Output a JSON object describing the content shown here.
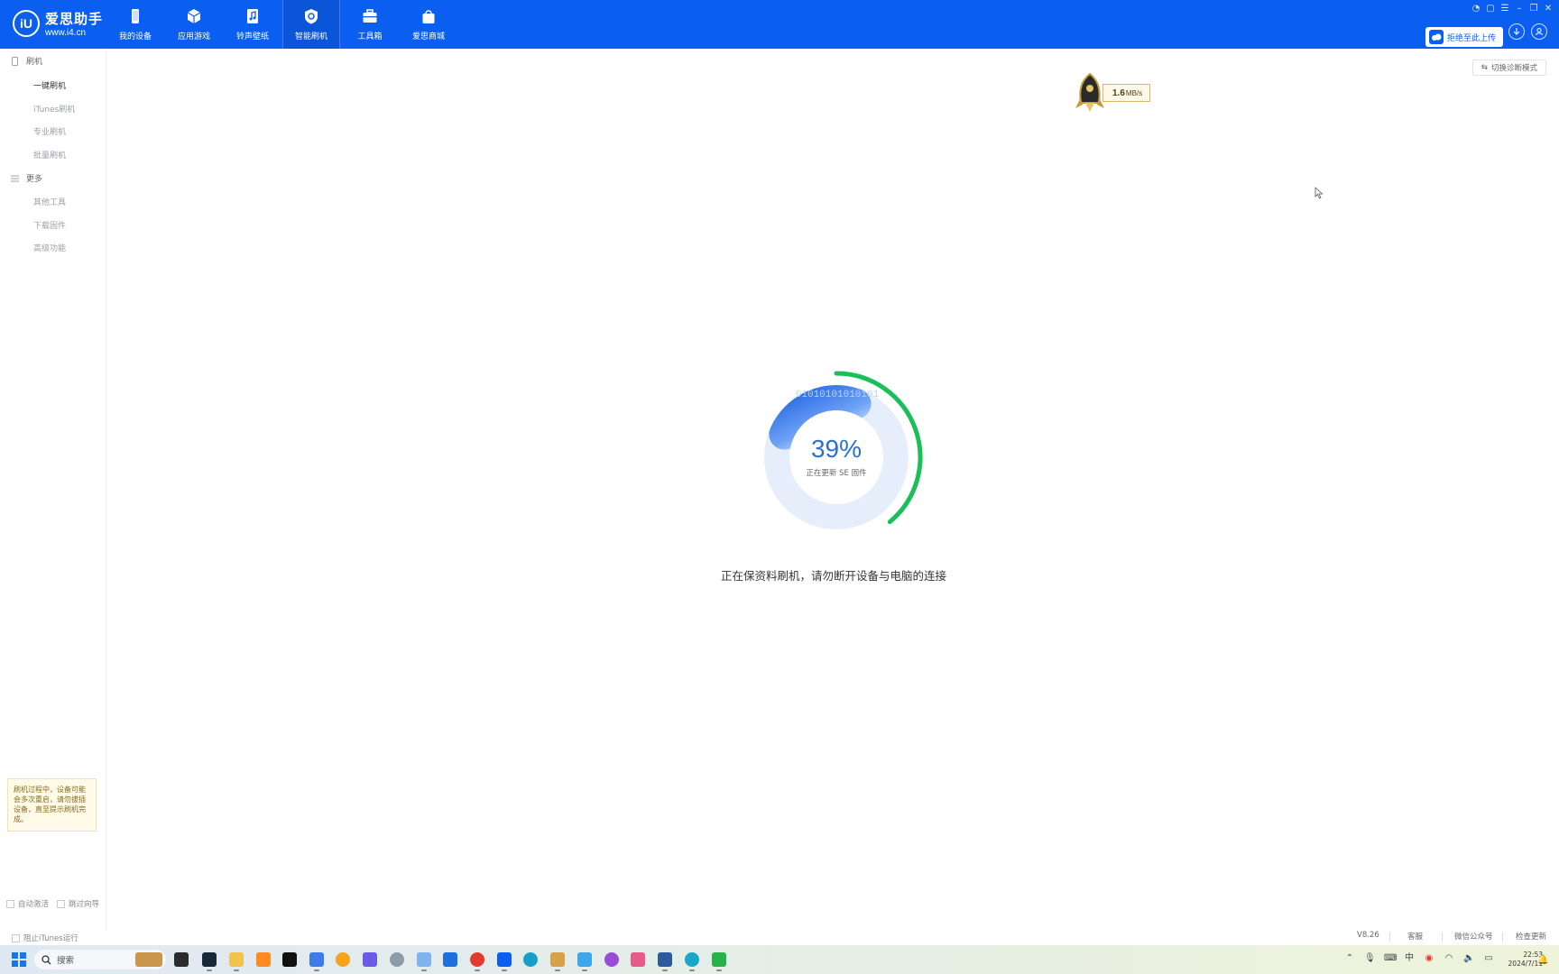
{
  "app": {
    "logo_mark": "iU",
    "logo_name": "爱思助手",
    "logo_url": "www.i4.cn"
  },
  "nav": {
    "tabs": [
      {
        "label": "我的设备",
        "icon": "phone-icon"
      },
      {
        "label": "应用游戏",
        "icon": "cube-icon"
      },
      {
        "label": "铃声壁纸",
        "icon": "music-file-icon"
      },
      {
        "label": "智能刷机",
        "icon": "shield-gear-icon",
        "active": true
      },
      {
        "label": "工具箱",
        "icon": "toolbox-icon"
      },
      {
        "label": "爱思商城",
        "icon": "shopping-bag-icon"
      }
    ]
  },
  "header": {
    "upload_label": "拒绝至此上传"
  },
  "sidebar": {
    "group_flash": "刷机",
    "items_flash": [
      {
        "label": "一键刷机",
        "active": true
      },
      {
        "label": "iTunes刷机"
      },
      {
        "label": "专业刷机"
      },
      {
        "label": "批量刷机"
      }
    ],
    "group_more": "更多",
    "items_more": [
      {
        "label": "其他工具"
      },
      {
        "label": "下载固件"
      },
      {
        "label": "高级功能"
      }
    ],
    "tip": "刷机过程中，设备可能会多次重启，请勿拔插设备，直至提示刷机完成。",
    "auto_activate": "自动激活",
    "skip_guide": "跳过向导",
    "block_itunes": "阻止iTunes运行"
  },
  "main": {
    "diag_button": "切换诊断模式",
    "speed_value": "1.6",
    "speed_unit": "MB/s",
    "progress": {
      "percent": 39,
      "label": "39%",
      "sub": "正在更新 SE 固件",
      "binary": "01010101010101"
    },
    "flash_message": "正在保资料刷机，请勿断开设备与电脑的连接"
  },
  "statusbar": {
    "version": "V8.26",
    "feedback": "客服",
    "wechat": "微信公众号",
    "update": "检查更新"
  },
  "taskbar": {
    "search_placeholder": "搜索",
    "clock_time": "22:53",
    "clock_date": "2024/7/11"
  },
  "colors": {
    "topbar": "#0b5ff0",
    "progress_green": "#1bbf5a",
    "progress_blue": "#2b6fcf",
    "track": "#e4ecfb"
  }
}
